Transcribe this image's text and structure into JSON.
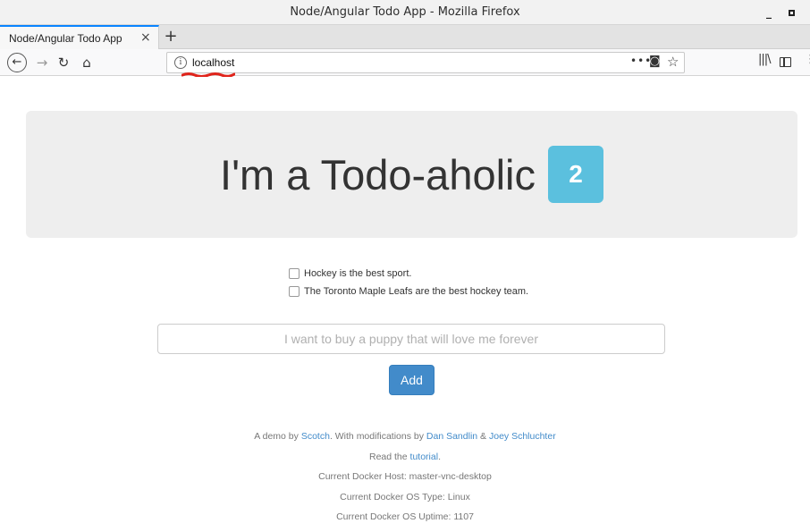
{
  "window": {
    "title": "Node/Angular Todo App - Mozilla Firefox",
    "minimize_glyph": "_"
  },
  "tabs": [
    {
      "label": "Node/Angular Todo App",
      "close_glyph": "×"
    }
  ],
  "new_tab_glyph": "+",
  "toolbar": {
    "url": "localhost",
    "icons": [
      "back-icon",
      "forward-icon",
      "reload-icon",
      "home-icon",
      "info-icon",
      "page-actions-icon",
      "pocket-icon",
      "bookmark-star-icon",
      "library-icon",
      "sidebar-icon",
      "menu-icon"
    ]
  },
  "header": {
    "title": "I'm a Todo-aholic",
    "count": "2",
    "badge_color": "#5bc0de"
  },
  "todos": [
    {
      "text": "Hockey is the best sport.",
      "checked": false
    },
    {
      "text": "The Toronto Maple Leafs are the best hockey team.",
      "checked": false
    }
  ],
  "form": {
    "placeholder": "I want to buy a puppy that will love me forever",
    "value": "",
    "add_label": "Add",
    "button_color": "#428bca"
  },
  "footer": {
    "demo_prefix": "A demo by",
    "scotch_link": "Scotch",
    "modifications_text": ". With modifications by",
    "author1_link": "Dan Sandlin",
    "ampersand": "&",
    "author2_link": "Joey Schluchter",
    "read_prefix": "Read the",
    "tutorial_link": "tutorial",
    "period": ".",
    "docker_host": "Current Docker Host: master-vnc-desktop",
    "docker_os_type": "Current Docker OS Type: Linux",
    "docker_uptime": "Current Docker OS Uptime: 1107",
    "link_color": "#428bca"
  }
}
